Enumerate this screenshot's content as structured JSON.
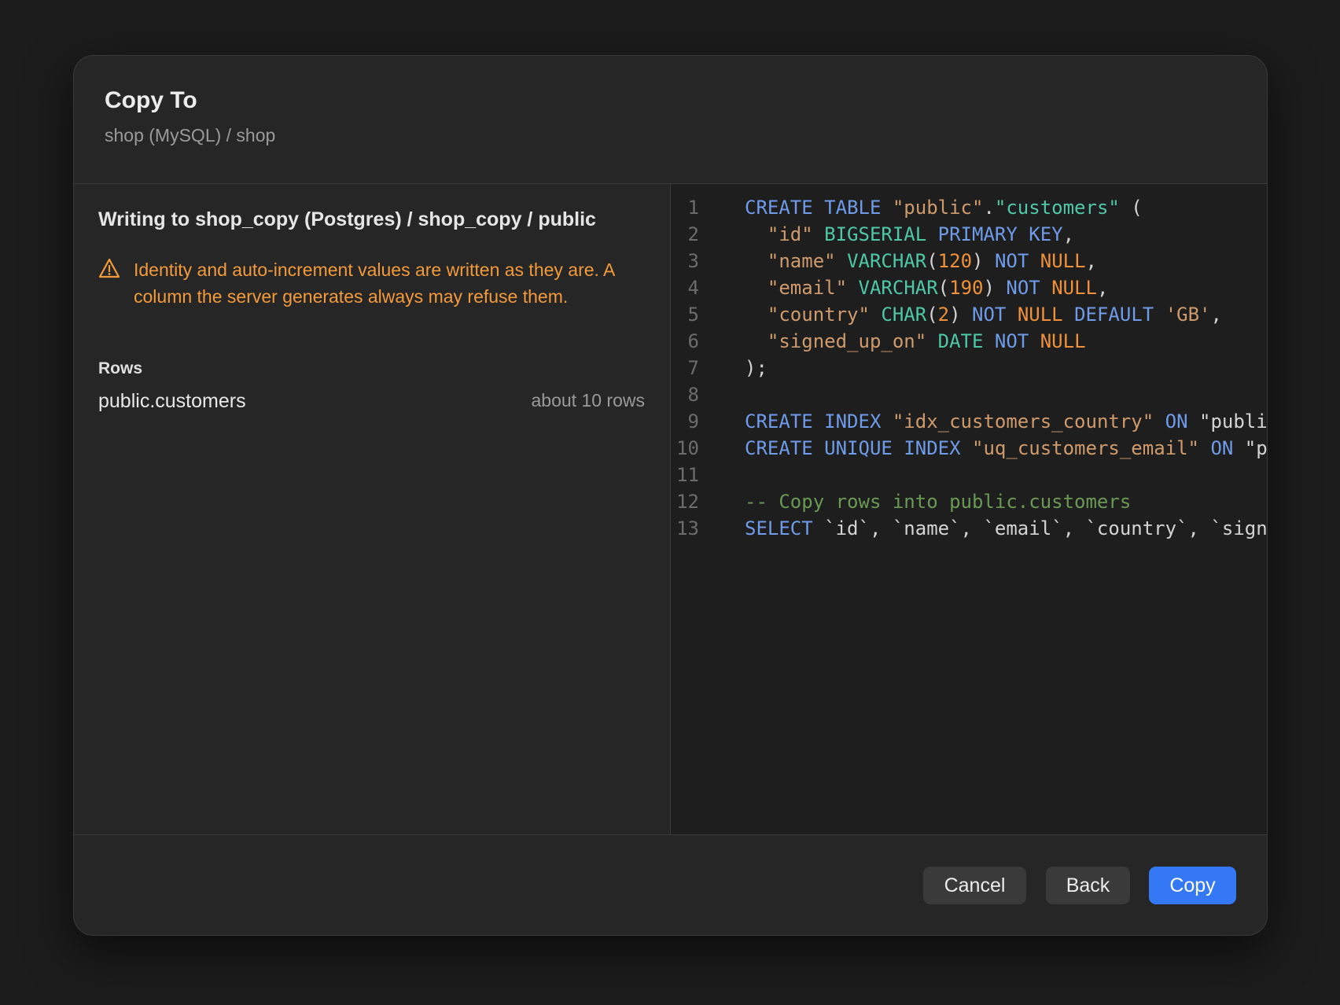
{
  "dialog": {
    "title": "Copy To",
    "source": "shop (MySQL) / shop"
  },
  "left": {
    "target_heading": "Writing to shop_copy (Postgres) / shop_copy / public",
    "warning_icon": "warning-triangle-icon",
    "warning_text": "Identity and auto-increment values are written as they are. A column the server generates always may refuse them.",
    "rows_label": "Rows",
    "rows": [
      {
        "name": "public.customers",
        "count": "about 10 rows"
      }
    ]
  },
  "code": {
    "lines": [
      {
        "n": "1",
        "tokens": [
          [
            "kw",
            "CREATE"
          ],
          [
            "",
            " "
          ],
          [
            "kw",
            "TABLE"
          ],
          [
            "",
            " "
          ],
          [
            "st",
            "\"public\""
          ],
          [
            "",
            "."
          ],
          [
            "ty",
            "\"customers\""
          ],
          [
            "",
            " ("
          ]
        ]
      },
      {
        "n": "2",
        "tokens": [
          [
            "",
            "  "
          ],
          [
            "st",
            "\"id\""
          ],
          [
            "",
            " "
          ],
          [
            "ty",
            "BIGSERIAL"
          ],
          [
            "",
            " "
          ],
          [
            "kw",
            "PRIMARY KEY"
          ],
          [
            "",
            ","
          ]
        ]
      },
      {
        "n": "3",
        "tokens": [
          [
            "",
            "  "
          ],
          [
            "st",
            "\"name\""
          ],
          [
            "",
            " "
          ],
          [
            "ty",
            "VARCHAR"
          ],
          [
            "",
            "("
          ],
          [
            "nu",
            "120"
          ],
          [
            "",
            ") "
          ],
          [
            "kw",
            "NOT"
          ],
          [
            "",
            " "
          ],
          [
            "nu",
            "NULL"
          ],
          [
            "",
            ","
          ]
        ]
      },
      {
        "n": "4",
        "tokens": [
          [
            "",
            "  "
          ],
          [
            "st",
            "\"email\""
          ],
          [
            "",
            " "
          ],
          [
            "ty",
            "VARCHAR"
          ],
          [
            "",
            "("
          ],
          [
            "nu",
            "190"
          ],
          [
            "",
            ") "
          ],
          [
            "kw",
            "NOT"
          ],
          [
            "",
            " "
          ],
          [
            "nu",
            "NULL"
          ],
          [
            "",
            ","
          ]
        ]
      },
      {
        "n": "5",
        "tokens": [
          [
            "",
            "  "
          ],
          [
            "st",
            "\"country\""
          ],
          [
            "",
            " "
          ],
          [
            "ty",
            "CHAR"
          ],
          [
            "",
            "("
          ],
          [
            "nu",
            "2"
          ],
          [
            "",
            ") "
          ],
          [
            "kw",
            "NOT"
          ],
          [
            "",
            " "
          ],
          [
            "nu",
            "NULL"
          ],
          [
            "",
            " "
          ],
          [
            "kw",
            "DEFAULT"
          ],
          [
            "",
            " "
          ],
          [
            "st",
            "'GB'"
          ],
          [
            "",
            ","
          ]
        ]
      },
      {
        "n": "6",
        "tokens": [
          [
            "",
            "  "
          ],
          [
            "st",
            "\"signed_up_on\""
          ],
          [
            "",
            " "
          ],
          [
            "ty",
            "DATE"
          ],
          [
            "",
            " "
          ],
          [
            "kw",
            "NOT"
          ],
          [
            "",
            " "
          ],
          [
            "nu",
            "NULL"
          ]
        ]
      },
      {
        "n": "7",
        "tokens": [
          [
            "",
            ");"
          ]
        ]
      },
      {
        "n": "8",
        "tokens": []
      },
      {
        "n": "9",
        "tokens": [
          [
            "kw",
            "CREATE"
          ],
          [
            "",
            " "
          ],
          [
            "kw",
            "INDEX"
          ],
          [
            "",
            " "
          ],
          [
            "st",
            "\"idx_customers_country\""
          ],
          [
            "",
            " "
          ],
          [
            "kw",
            "ON"
          ],
          [
            "",
            " \"public\".\"customers\""
          ]
        ]
      },
      {
        "n": "10",
        "tokens": [
          [
            "kw",
            "CREATE"
          ],
          [
            "",
            " "
          ],
          [
            "kw",
            "UNIQUE"
          ],
          [
            "",
            " "
          ],
          [
            "kw",
            "INDEX"
          ],
          [
            "",
            " "
          ],
          [
            "st",
            "\"uq_customers_email\""
          ],
          [
            "",
            " "
          ],
          [
            "kw",
            "ON"
          ],
          [
            "",
            " \"public\".\"customers\""
          ]
        ]
      },
      {
        "n": "11",
        "tokens": []
      },
      {
        "n": "12",
        "tokens": [
          [
            "cm",
            "-- Copy rows into public.customers"
          ]
        ]
      },
      {
        "n": "13",
        "tokens": [
          [
            "kw",
            "SELECT"
          ],
          [
            "",
            " `id`, `name`, `email`, `country`, `signed_up_on`"
          ]
        ]
      }
    ]
  },
  "footer": {
    "cancel_label": "Cancel",
    "back_label": "Back",
    "copy_label": "Copy"
  },
  "colors": {
    "accent": "#3478f6",
    "warning": "#f39a3b",
    "keyword": "#6f9be9",
    "type": "#4ec9a4",
    "number": "#f0913a",
    "string": "#cf9a6c",
    "comment": "#6a9955"
  }
}
